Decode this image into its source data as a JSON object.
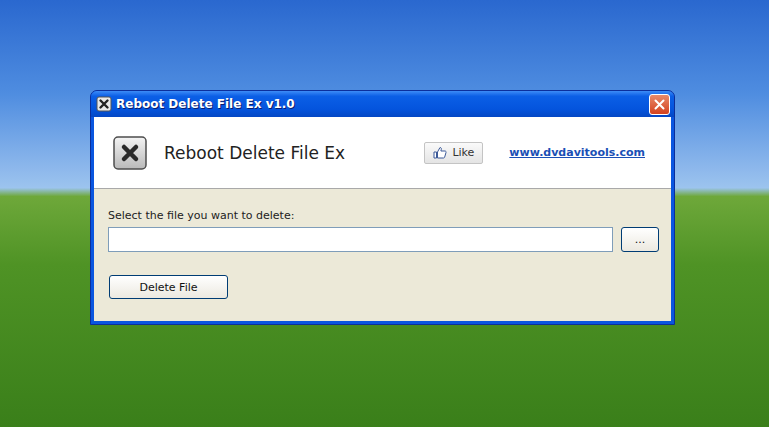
{
  "window": {
    "title": "Reboot Delete File Ex v1.0"
  },
  "header": {
    "app_name": "Reboot Delete File Ex",
    "like_button": "Like",
    "link": "www.dvdavitools.com"
  },
  "file_field": {
    "label": "Select the file you want to delete:",
    "value": "",
    "browse_button": "..."
  },
  "buttons": [
    "Delete File"
  ]
}
